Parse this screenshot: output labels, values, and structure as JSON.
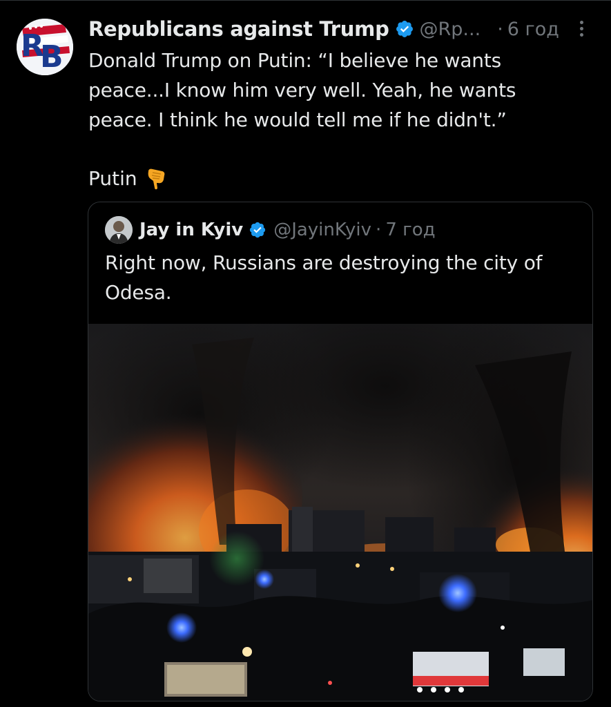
{
  "tweet": {
    "author_name": "Republicans against Trump",
    "author_handle": "@Rp...",
    "separator": "·",
    "time": "6 год",
    "avatar_letters": "RB",
    "text": "Donald Trump on Putin: “I believe he wants peace...I know him very well. Yeah, he wants peace. I think he would tell me if he didn't.”",
    "text2": "Putin",
    "point_icon": "backhand-index-pointing-down-emoji"
  },
  "quoted_tweet": {
    "author_name": "Jay in Kyiv",
    "author_handle": "@JayinKyiv",
    "separator": "·",
    "time": "7 год",
    "text": "Right now, Russians are destroying the city of Odesa.",
    "media_description": "Night photo of large fires and black smoke over city buildings"
  },
  "colors": {
    "background": "#000000",
    "text": "#e7e9ea",
    "secondary": "#71767b",
    "verified": "#1d9bf0",
    "border": "#2f3336"
  }
}
